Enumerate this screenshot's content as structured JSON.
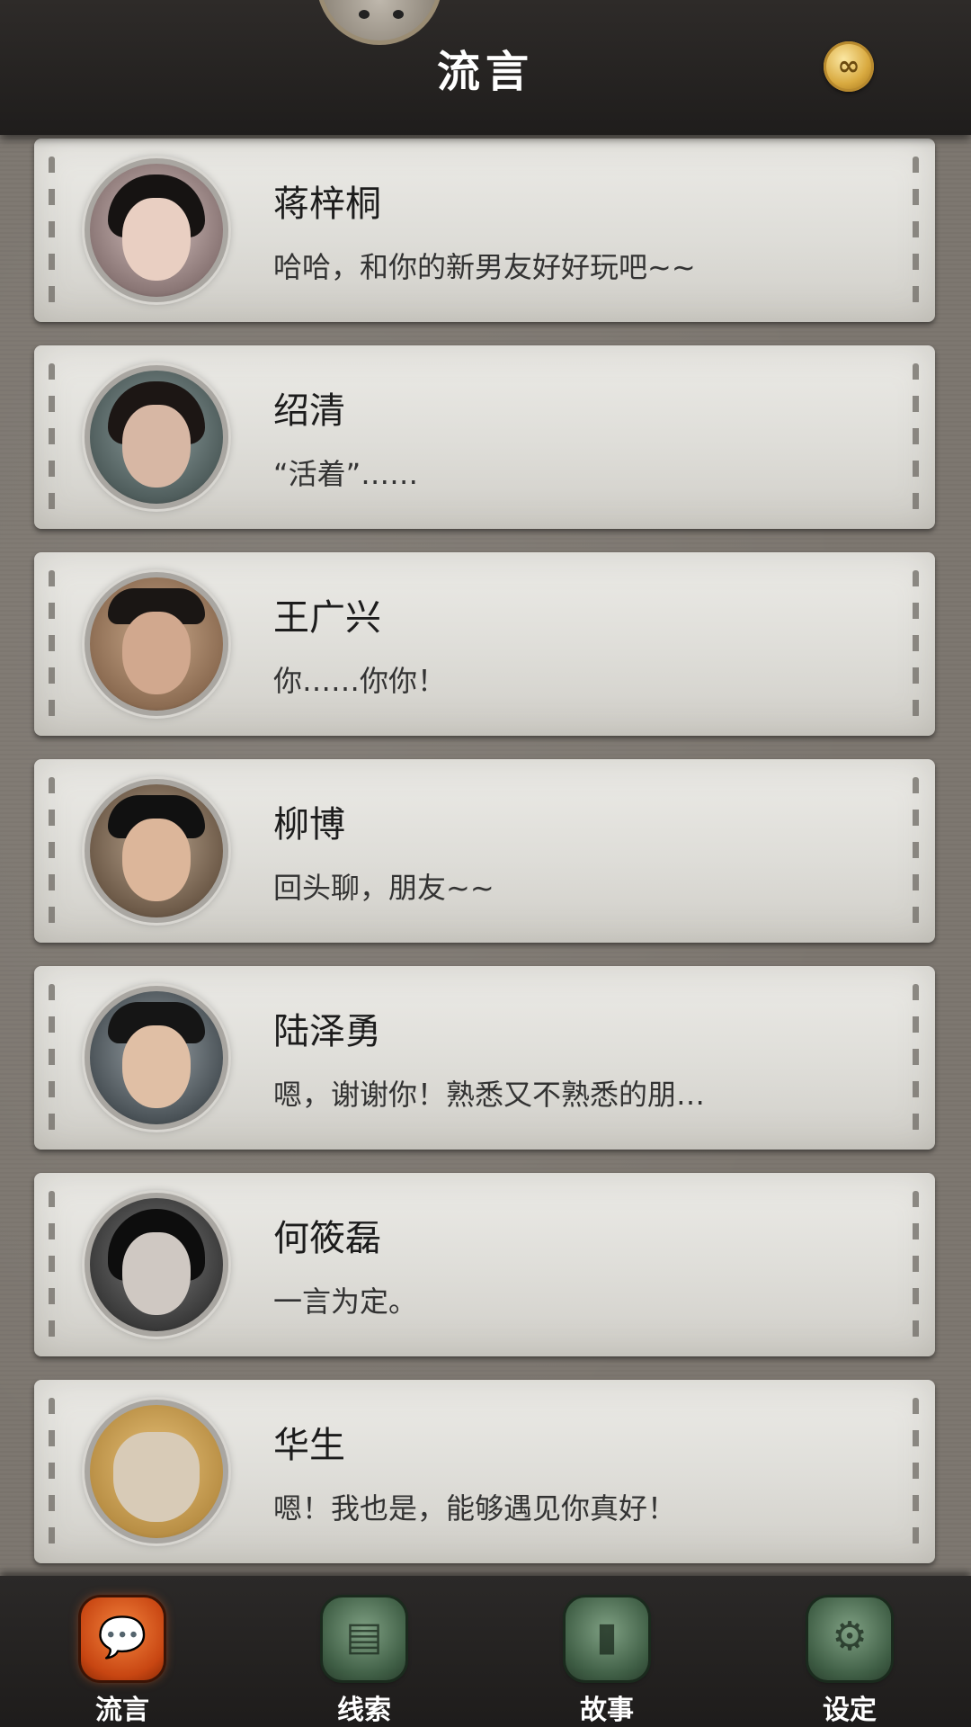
{
  "header": {
    "title": "流言",
    "coin_icon": "infinity-coin-icon",
    "coin_glyph": "∞"
  },
  "contacts": [
    {
      "name": "蒋梓桐",
      "message": "哈哈，和你的新男友好好玩吧~~"
    },
    {
      "name": "绍清",
      "message": "“活着”……"
    },
    {
      "name": "王广兴",
      "message": "你……你你！"
    },
    {
      "name": "柳博",
      "message": "回头聊，朋友~~"
    },
    {
      "name": "陆泽勇",
      "message": "嗯，谢谢你！熟悉又不熟悉的朋…"
    },
    {
      "name": "何筱磊",
      "message": "一言为定。"
    },
    {
      "name": "华生",
      "message": "嗯！我也是，能够遇见你真好！"
    }
  ],
  "nav": [
    {
      "label": "流言",
      "icon": "chat-bubble-icon",
      "active": true
    },
    {
      "label": "线索",
      "icon": "clue-paper-icon",
      "active": false
    },
    {
      "label": "故事",
      "icon": "story-book-icon",
      "active": false
    },
    {
      "label": "设定",
      "icon": "settings-gear-icon",
      "active": false
    }
  ],
  "colors": {
    "active_tab": "#e0621f",
    "inactive_tab": "#4f6e55",
    "header_bg": "#262322"
  }
}
